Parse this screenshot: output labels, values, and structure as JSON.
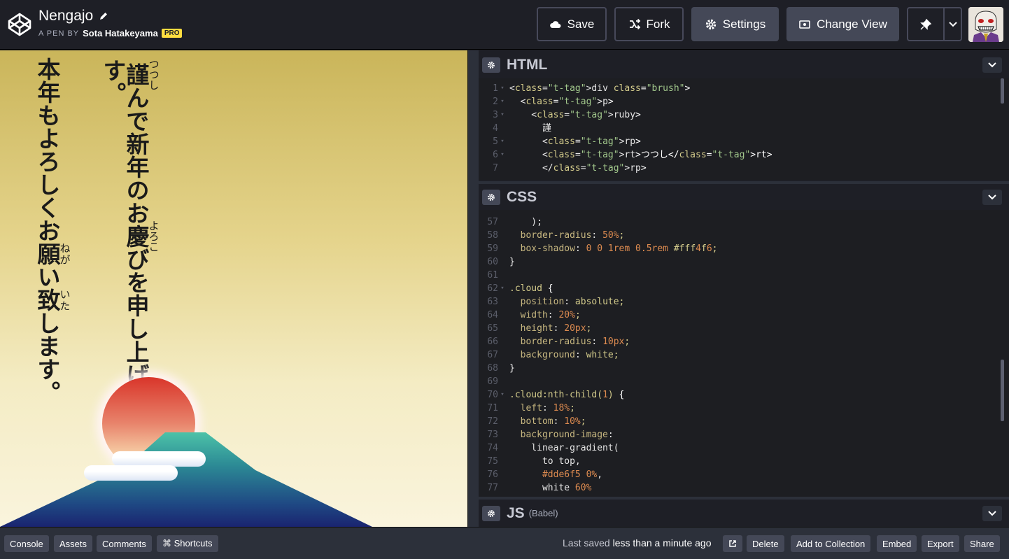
{
  "header": {
    "title": "Nengajo",
    "byline_prefix": "A PEN BY",
    "author": "Sota Hatakeyama",
    "pro_badge": "PRO",
    "buttons": {
      "save": "Save",
      "fork": "Fork",
      "settings": "Settings",
      "change_view": "Change View"
    }
  },
  "preview": {
    "column_right": {
      "pre": "",
      "kanji1": "謹",
      "ruby1": "つつし",
      "mid": "んで新年のお",
      "kanji2": "慶",
      "ruby2": "よろこ",
      "post": "びを申し上げます。"
    },
    "column_left": {
      "pre": "本年もよろしくお",
      "kanji1": "願",
      "ruby1": "ねが",
      "mid": "い",
      "kanji2": "致",
      "ruby2": "いた",
      "post": "します。"
    }
  },
  "panels": {
    "html": {
      "title": "HTML"
    },
    "css": {
      "title": "CSS"
    },
    "js": {
      "title": "JS",
      "sub": "(Babel)"
    }
  },
  "html_code": [
    {
      "n": "1",
      "f": "▾",
      "s": "<div class=\"brush\">"
    },
    {
      "n": "2",
      "f": "▾",
      "s": "  <p>"
    },
    {
      "n": "3",
      "f": "▾",
      "s": "    <ruby>"
    },
    {
      "n": "4",
      "f": "",
      "s": "      謹"
    },
    {
      "n": "5",
      "f": "▾",
      "s": "      <rp>"
    },
    {
      "n": "6",
      "f": "▾",
      "s": "      <rt>つつし</rt>"
    },
    {
      "n": "7",
      "f": "",
      "s": "      </rp>"
    }
  ],
  "css_code": [
    {
      "n": "57",
      "f": "",
      "s": "    );"
    },
    {
      "n": "58",
      "f": "",
      "s": "  border-radius: 50%;"
    },
    {
      "n": "59",
      "f": "",
      "s": "  box-shadow: 0 0 1rem 0.5rem #fff4f6;"
    },
    {
      "n": "60",
      "f": "",
      "s": "}"
    },
    {
      "n": "61",
      "f": "",
      "s": ""
    },
    {
      "n": "62",
      "f": "▾",
      "s": ".cloud {"
    },
    {
      "n": "63",
      "f": "",
      "s": "  position: absolute;"
    },
    {
      "n": "64",
      "f": "",
      "s": "  width: 20%;"
    },
    {
      "n": "65",
      "f": "",
      "s": "  height: 20px;"
    },
    {
      "n": "66",
      "f": "",
      "s": "  border-radius: 10px;"
    },
    {
      "n": "67",
      "f": "",
      "s": "  background: white;"
    },
    {
      "n": "68",
      "f": "",
      "s": "}"
    },
    {
      "n": "69",
      "f": "",
      "s": ""
    },
    {
      "n": "70",
      "f": "▾",
      "s": ".cloud:nth-child(1) {"
    },
    {
      "n": "71",
      "f": "",
      "s": "  left: 18%;"
    },
    {
      "n": "72",
      "f": "",
      "s": "  bottom: 10%;"
    },
    {
      "n": "73",
      "f": "",
      "s": "  background-image:"
    },
    {
      "n": "74",
      "f": "",
      "s": "    linear-gradient("
    },
    {
      "n": "75",
      "f": "",
      "s": "      to top,"
    },
    {
      "n": "76",
      "f": "",
      "s": "      #dde6f5 0%,"
    },
    {
      "n": "77",
      "f": "",
      "s": "      white 60%"
    }
  ],
  "footer": {
    "console": "Console",
    "assets": "Assets",
    "comments": "Comments",
    "shortcuts": "⌘ Shortcuts",
    "saved_prefix": "Last saved",
    "saved_time": "less than a minute ago",
    "delete": "Delete",
    "add_to_collection": "Add to Collection",
    "embed": "Embed",
    "export": "Export",
    "share": "Share"
  }
}
